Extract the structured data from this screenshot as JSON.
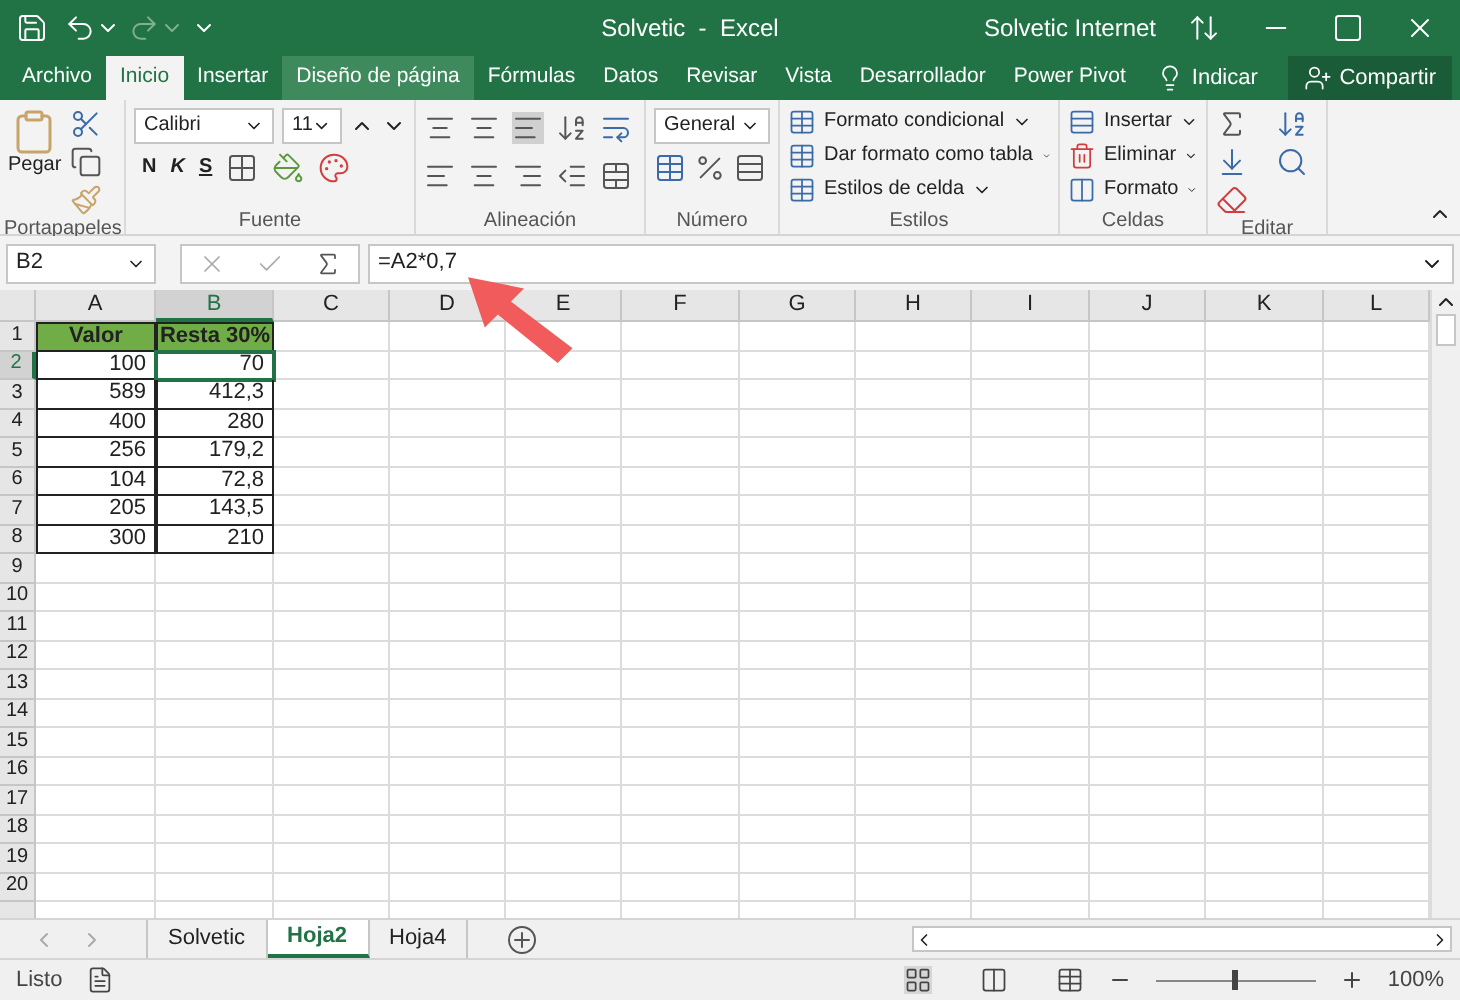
{
  "window": {
    "title": "Solvetic  -  Excel",
    "account": "Solvetic Internet"
  },
  "tabs": [
    {
      "label": "Archivo",
      "selected": false
    },
    {
      "label": "Inicio",
      "selected": true
    },
    {
      "label": "Insertar",
      "selected": false
    },
    {
      "label": "Diseño de página",
      "selected": false
    },
    {
      "label": "Fórmulas",
      "selected": false
    },
    {
      "label": "Datos",
      "selected": false
    },
    {
      "label": "Revisar",
      "selected": false
    },
    {
      "label": "Vista",
      "selected": false
    },
    {
      "label": "Desarrollador",
      "selected": false
    },
    {
      "label": "Power Pivot",
      "selected": false
    }
  ],
  "tell_me": "Indicar",
  "share": "Compartir",
  "ribbon": {
    "paste": "Pegar",
    "font_name": "Calibri",
    "font_size": "11",
    "bold": "N",
    "italic": "K",
    "underline": "S",
    "number_format": "General",
    "styles": [
      "Formato condicional",
      "Dar formato como tabla",
      "Estilos de celda"
    ],
    "cells": [
      "Insertar",
      "Eliminar",
      "Formato"
    ],
    "groups": [
      "Portapapeles",
      "Fuente",
      "Alineación",
      "Número",
      "Estilos",
      "Celdas",
      "Editar"
    ]
  },
  "name_box": "B2",
  "formula": "=A2*0,7",
  "columns": [
    {
      "label": "A",
      "selected": false
    },
    {
      "label": "B",
      "selected": true
    },
    {
      "label": "C",
      "selected": false
    },
    {
      "label": "D",
      "selected": false
    },
    {
      "label": "E",
      "selected": false
    },
    {
      "label": "F",
      "selected": false
    },
    {
      "label": "G",
      "selected": false
    },
    {
      "label": "H",
      "selected": false
    },
    {
      "label": "I",
      "selected": false
    },
    {
      "label": "J",
      "selected": false
    },
    {
      "label": "K",
      "selected": false
    },
    {
      "label": "L",
      "selected": false
    }
  ],
  "rows": [
    {
      "label": "1",
      "selected": false,
      "kind": "header",
      "cells": [
        "Valor",
        "Resta 30%"
      ]
    },
    {
      "label": "2",
      "selected": true,
      "kind": "value",
      "cells": [
        "100",
        "70"
      ]
    },
    {
      "label": "3",
      "selected": false,
      "kind": "value",
      "cells": [
        "589",
        "412,3"
      ]
    },
    {
      "label": "4",
      "selected": false,
      "kind": "value",
      "cells": [
        "400",
        "280"
      ]
    },
    {
      "label": "5",
      "selected": false,
      "kind": "value",
      "cells": [
        "256",
        "179,2"
      ]
    },
    {
      "label": "6",
      "selected": false,
      "kind": "value",
      "cells": [
        "104",
        "72,8"
      ]
    },
    {
      "label": "7",
      "selected": false,
      "kind": "value",
      "cells": [
        "205",
        "143,5"
      ]
    },
    {
      "label": "8",
      "selected": false,
      "kind": "value",
      "cells": [
        "300",
        "210"
      ]
    },
    {
      "label": "9",
      "selected": false
    },
    {
      "label": "10",
      "selected": false
    },
    {
      "label": "11",
      "selected": false
    },
    {
      "label": "12",
      "selected": false
    },
    {
      "label": "13",
      "selected": false
    },
    {
      "label": "14",
      "selected": false
    },
    {
      "label": "15",
      "selected": false
    },
    {
      "label": "16",
      "selected": false
    },
    {
      "label": "17",
      "selected": false
    },
    {
      "label": "18",
      "selected": false
    },
    {
      "label": "19",
      "selected": false
    },
    {
      "label": "20",
      "selected": false
    }
  ],
  "sheets": [
    {
      "label": "Solvetic",
      "selected": false
    },
    {
      "label": "Hoja2",
      "selected": true
    },
    {
      "label": "Hoja4",
      "selected": false
    }
  ],
  "status": {
    "text": "Listo",
    "zoom": "100%"
  },
  "zoom_slider": {
    "level": 0.5
  }
}
